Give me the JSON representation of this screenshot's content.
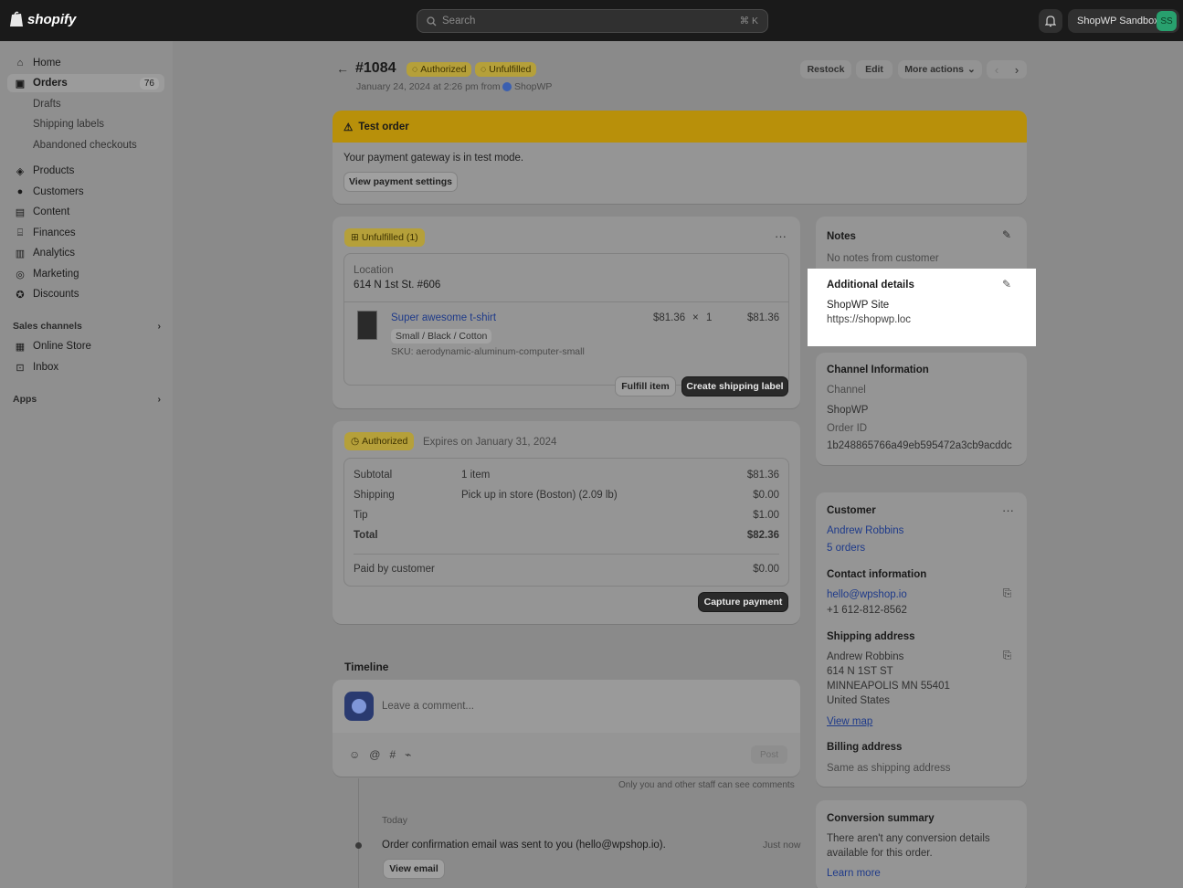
{
  "topbar": {
    "brand": "shopify",
    "search_placeholder": "Search",
    "search_shortcut": "⌘ K",
    "store_name": "ShopWP Sandbox",
    "avatar_initials": "SS"
  },
  "sidebar": {
    "items": [
      {
        "label": "Home"
      },
      {
        "label": "Orders",
        "badge": "76"
      },
      {
        "label": "Drafts"
      },
      {
        "label": "Shipping labels"
      },
      {
        "label": "Abandoned checkouts"
      },
      {
        "label": "Products"
      },
      {
        "label": "Customers"
      },
      {
        "label": "Content"
      },
      {
        "label": "Finances"
      },
      {
        "label": "Analytics"
      },
      {
        "label": "Marketing"
      },
      {
        "label": "Discounts"
      }
    ],
    "sales_channels_label": "Sales channels",
    "channels": [
      {
        "label": "Online Store"
      },
      {
        "label": "Inbox"
      }
    ],
    "apps_label": "Apps"
  },
  "header": {
    "order_number": "#1084",
    "tag_authorized": "Authorized",
    "tag_unfulfilled": "Unfulfilled",
    "subtitle": "January 24, 2024 at 2:26 pm from",
    "source": "ShopWP",
    "restock": "Restock",
    "edit": "Edit",
    "more_actions": "More actions"
  },
  "test_order": {
    "title": "Test order",
    "message": "Your payment gateway is in test mode.",
    "button": "View payment settings"
  },
  "fulfillment": {
    "tag": "Unfulfilled (1)",
    "location_label": "Location",
    "location_value": "614 N 1st St. #606",
    "product_name": "Super awesome t-shirt",
    "variant": "Small / Black / Cotton",
    "sku": "SKU: aerodynamic-aluminum-computer-small",
    "price": "$81.36",
    "multiply": "×",
    "qty": "1",
    "line_total": "$81.36",
    "fulfill_button": "Fulfill item",
    "shipping_label_button": "Create shipping label"
  },
  "payment": {
    "tag": "Authorized",
    "expires": "Expires on January 31, 2024",
    "rows": [
      {
        "label": "Subtotal",
        "detail": "1 item",
        "amount": "$81.36"
      },
      {
        "label": "Shipping",
        "detail": "Pick up in store (Boston) (2.09 lb)",
        "amount": "$0.00"
      },
      {
        "label": "Tip",
        "detail": "",
        "amount": "$1.00"
      },
      {
        "label": "Total",
        "detail": "",
        "amount": "$82.36"
      }
    ],
    "paid_label": "Paid by customer",
    "paid_amount": "$0.00",
    "capture_button": "Capture payment"
  },
  "timeline": {
    "title": "Timeline",
    "comment_placeholder": "Leave a comment...",
    "post_button": "Post",
    "staff_note": "Only you and other staff can see comments",
    "day": "Today",
    "event": "Order confirmation email was sent to you (hello@wpshop.io).",
    "event_time": "Just now",
    "view_email": "View email"
  },
  "notes": {
    "title": "Notes",
    "value": "No notes from customer"
  },
  "additional": {
    "title": "Additional details",
    "label": "ShopWP Site",
    "value": "https://shopwp.loc"
  },
  "channel": {
    "title": "Channel Information",
    "channel_label": "Channel",
    "channel_value": "ShopWP",
    "order_id_label": "Order ID",
    "order_id_value": "1b248865766a49eb595472a3cb9acddc"
  },
  "customer": {
    "title": "Customer",
    "name": "Andrew Robbins",
    "orders": "5 orders",
    "contact_title": "Contact information",
    "email": "hello@wpshop.io",
    "phone": "+1 612-812-8562",
    "shipping_title": "Shipping address",
    "ship_lines": [
      "Andrew Robbins",
      "614 N 1ST ST",
      "MINNEAPOLIS MN 55401",
      "United States"
    ],
    "view_map": "View map",
    "billing_title": "Billing address",
    "billing_value": "Same as shipping address"
  },
  "conversion": {
    "title": "Conversion summary",
    "text1": "There aren't any conversion details",
    "text2": "available for this order.",
    "learn_more": "Learn more"
  }
}
